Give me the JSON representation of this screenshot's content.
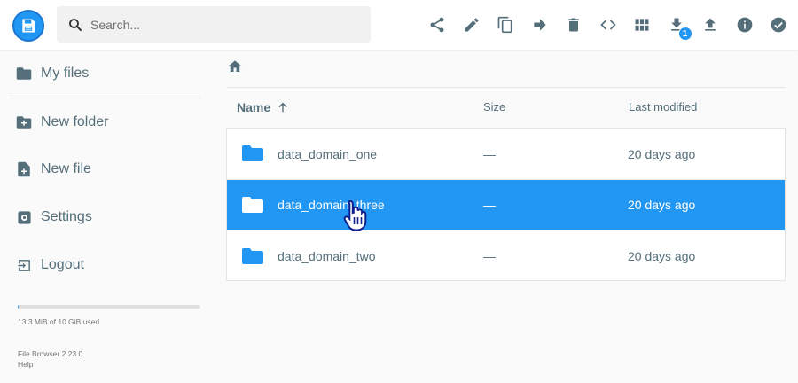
{
  "header": {
    "search_placeholder": "Search...",
    "toolbar": [
      {
        "name": "share-icon"
      },
      {
        "name": "rename-icon"
      },
      {
        "name": "copy-icon"
      },
      {
        "name": "move-icon"
      },
      {
        "name": "delete-icon"
      },
      {
        "name": "code-icon"
      },
      {
        "name": "grid-view-icon"
      },
      {
        "name": "download-icon",
        "badge": "1"
      },
      {
        "name": "upload-icon"
      },
      {
        "name": "info-icon"
      },
      {
        "name": "check-circle-icon"
      }
    ]
  },
  "sidebar": {
    "items": [
      {
        "label": "My files",
        "icon": "folder-icon"
      },
      {
        "label": "New folder",
        "icon": "create-folder-icon"
      },
      {
        "label": "New file",
        "icon": "note-add-icon"
      },
      {
        "label": "Settings",
        "icon": "settings-icon"
      },
      {
        "label": "Logout",
        "icon": "logout-icon"
      }
    ],
    "usage_text": "13.3 MiB of 10 GiB used",
    "usage_fraction": 0.0013,
    "version": "File Browser 2.23.0",
    "help": "Help"
  },
  "listing": {
    "headers": {
      "name": "Name",
      "size": "Size",
      "modified": "Last modified"
    },
    "rows": [
      {
        "name": "data_domain_one",
        "size": "—",
        "modified": "20 days ago",
        "selected": false
      },
      {
        "name": "data_domain_three",
        "size": "—",
        "modified": "20 days ago",
        "selected": true
      },
      {
        "name": "data_domain_two",
        "size": "—",
        "modified": "20 days ago",
        "selected": false
      }
    ]
  },
  "colors": {
    "accent": "#2196f3",
    "text": "#546e7a",
    "icon": "#546e7a"
  }
}
